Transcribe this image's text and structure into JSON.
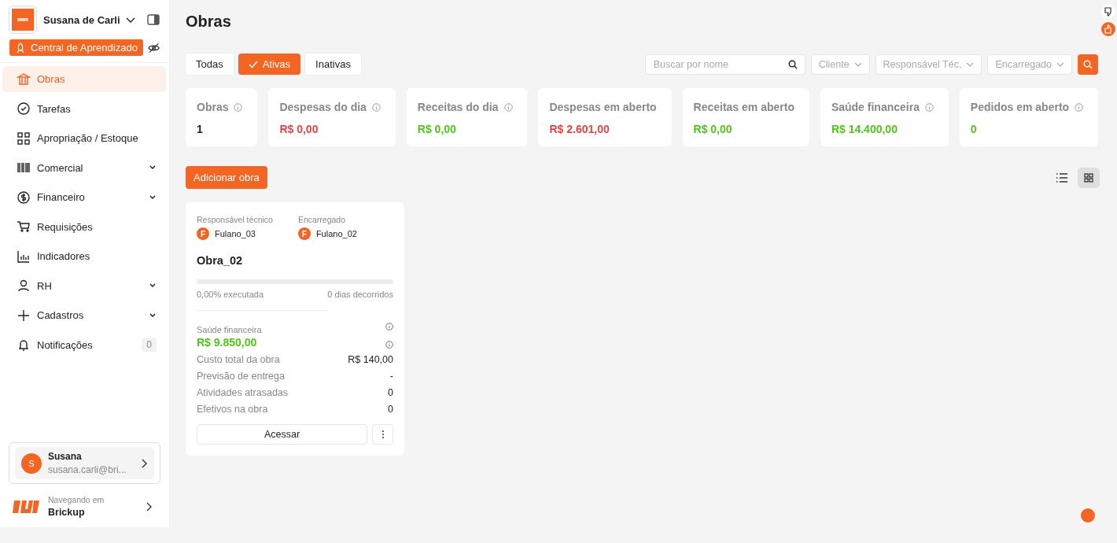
{
  "account": {
    "name": "Susana de Carli"
  },
  "learning_button": {
    "label": "Central de Aprendizado"
  },
  "sidebar": {
    "items": [
      {
        "label": "Obras",
        "kind": "link",
        "selected": true
      },
      {
        "label": "Tarefas",
        "kind": "link",
        "selected": false
      },
      {
        "label": "Apropriação / Estoque",
        "kind": "link",
        "selected": false
      },
      {
        "label": "Comercial",
        "kind": "group",
        "selected": false,
        "expanded": false
      },
      {
        "label": "Financeiro",
        "kind": "group",
        "selected": false,
        "expanded": false
      },
      {
        "label": "Requisições",
        "kind": "link",
        "selected": false
      },
      {
        "label": "Indicadores",
        "kind": "link",
        "selected": false
      },
      {
        "label": "RH",
        "kind": "group",
        "selected": false,
        "expanded": false
      },
      {
        "label": "Cadastros",
        "kind": "group",
        "selected": false,
        "expanded": false
      },
      {
        "label": "Notificações",
        "kind": "link",
        "selected": false,
        "badge": "0"
      }
    ]
  },
  "user": {
    "initial": "S",
    "name": "Susana",
    "email": "susana.carli@bri..."
  },
  "workspace": {
    "caption": "Navegando em",
    "name": "Brickup"
  },
  "page": {
    "title": "Obras"
  },
  "filters": {
    "tabs": [
      {
        "label": "Todas",
        "selected": false
      },
      {
        "label": "Ativas",
        "selected": true
      },
      {
        "label": "Inativas",
        "selected": false
      }
    ],
    "search": {
      "placeholder": "Buscar por nome"
    },
    "dropdowns": [
      "Cliente",
      "Responsável Téc.",
      "Encarregado"
    ]
  },
  "stats": [
    {
      "label": "Obras",
      "value": "1",
      "kind": "neutral",
      "info": true
    },
    {
      "label": "Despesas do dia",
      "value": "R$ 0,00",
      "kind": "negative",
      "info": true
    },
    {
      "label": "Receitas do dia",
      "value": "R$ 0,00",
      "kind": "positive",
      "info": true
    },
    {
      "label": "Despesas em aberto",
      "value": "R$ 2.601,00",
      "kind": "negative",
      "info": false
    },
    {
      "label": "Receitas em aberto",
      "value": "R$ 0,00",
      "kind": "positive",
      "info": false
    },
    {
      "label": "Saúde financeira",
      "value": "R$ 14.400,00",
      "kind": "positive",
      "info": true
    },
    {
      "label": "Pedidos em aberto",
      "value": "0",
      "kind": "positive",
      "info": true
    }
  ],
  "add_button": {
    "label": "Adicionar obra"
  },
  "view_toggle": [
    {
      "kind": "list",
      "selected": false
    },
    {
      "kind": "grid",
      "selected": true
    }
  ],
  "projects": [
    {
      "people": [
        {
          "role": "Responsável técnico",
          "initial": "F",
          "name": "Fulano_03"
        },
        {
          "role": "Encarregado",
          "initial": "F",
          "name": "Fulano_02"
        }
      ],
      "name": "Obra_02",
      "level": 0,
      "progress_text": "0,00% executada",
      "days_text": "0 dias decorridos",
      "health_label": "Saúde financeira",
      "health_value": "R$ 9.850,00",
      "rows": [
        {
          "label": "Custo total da obra",
          "value": "R$ 140,00"
        },
        {
          "label": "Previsão de entrega",
          "value": "-"
        },
        {
          "label": "Atividades atrasadas",
          "value": "0"
        },
        {
          "label": "Efetivos na obra",
          "value": "0"
        }
      ],
      "action": "Acessar"
    }
  ]
}
